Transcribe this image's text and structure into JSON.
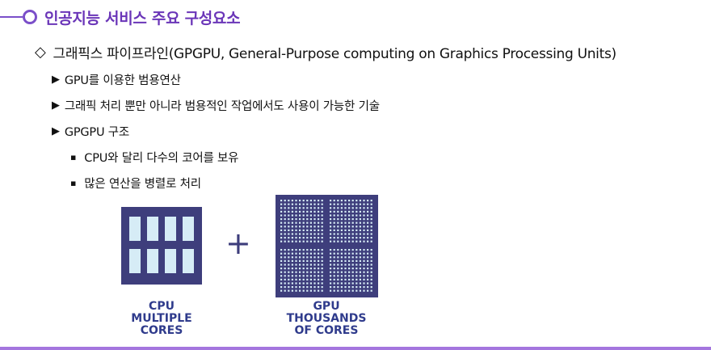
{
  "title": "인공지능 서비스 주요 구성요소",
  "section": {
    "marker": "◇",
    "heading": "그래픽스 파이프라인(GPGPU, General-Purpose computing on Graphics Processing Units)"
  },
  "points": [
    {
      "marker": "▶",
      "text": "GPU를 이용한 범용연산"
    },
    {
      "marker": "▶",
      "text": "그래픽 처리 뿐만 아니라 범용적인 작업에서도 사용이 가능한 기술"
    },
    {
      "marker": "▶",
      "text": "GPGPU 구조"
    }
  ],
  "sub_points": [
    {
      "marker": "▪",
      "text": "CPU와 달리 다수의 코어를 보유"
    },
    {
      "marker": "▪",
      "text": "많은 연산을 병렬로 처리"
    }
  ],
  "diagram": {
    "plus": "+",
    "cpu_caption": [
      "CPU",
      "MULTIPLE",
      "CORES"
    ],
    "gpu_caption": [
      "GPU",
      "THOUSANDS",
      "OF CORES"
    ],
    "chip_color": "#3e3e7c",
    "core_color": "#d6ecf6",
    "caption_color": "#2f3b8c"
  },
  "colors": {
    "accent": "#7b4fc9",
    "bottom_rule": "#a476de"
  }
}
